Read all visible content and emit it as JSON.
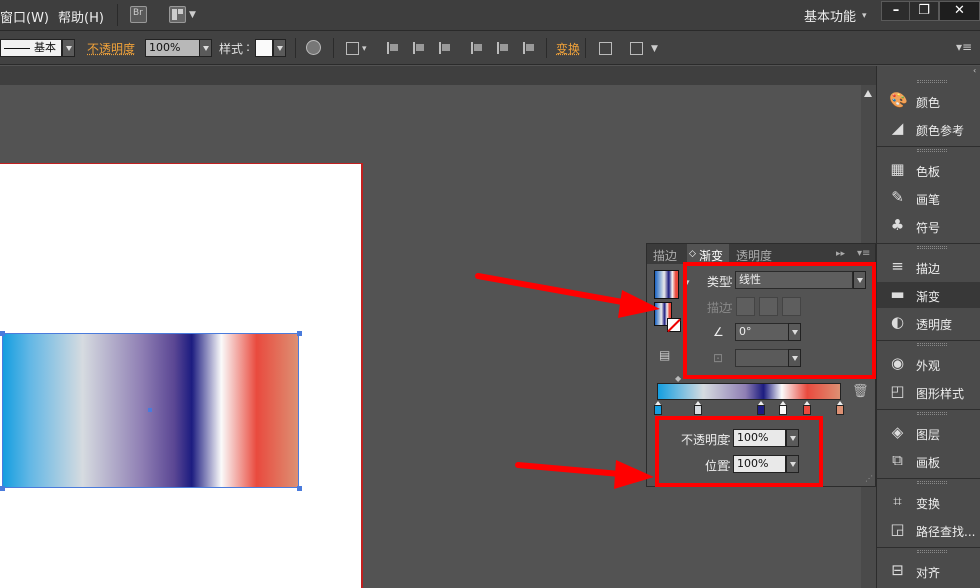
{
  "menubar": {
    "items": [
      "窗口(W)",
      "帮助(H)"
    ],
    "workspace": "基本功能",
    "window_buttons": [
      "–",
      "❐",
      "✕"
    ]
  },
  "controlbar": {
    "stroke_style": "基本",
    "opacity_label": "不透明度",
    "opacity_value": "100%",
    "style_label": "样式",
    "transform_label": "变换"
  },
  "gradient_panel": {
    "tabs": [
      "描边",
      "渐变",
      "透明度"
    ],
    "active_tab": "渐变",
    "type_label": "类型",
    "type_value": "线性",
    "stroke_label": "描边",
    "angle_value": "0°",
    "opacity_label": "不透明度",
    "opacity_value": "100%",
    "location_label": "位置",
    "location_value": "100%",
    "stop_count": 6
  },
  "dock": {
    "items": [
      {
        "label": "颜色",
        "icon": "palette-icon",
        "glyph": "🎨"
      },
      {
        "label": "颜色参考",
        "icon": "color-guide-icon",
        "glyph": "◢"
      },
      {
        "label": "色板",
        "icon": "swatches-icon",
        "glyph": "▦"
      },
      {
        "label": "画笔",
        "icon": "brushes-icon",
        "glyph": "✎"
      },
      {
        "label": "符号",
        "icon": "symbols-icon",
        "glyph": "♣"
      },
      {
        "label": "描边",
        "icon": "stroke-icon",
        "glyph": "≡"
      },
      {
        "label": "渐变",
        "icon": "gradient-icon",
        "glyph": "▬"
      },
      {
        "label": "透明度",
        "icon": "transparency-icon",
        "glyph": "◐"
      },
      {
        "label": "外观",
        "icon": "appearance-icon",
        "glyph": "◉"
      },
      {
        "label": "图形样式",
        "icon": "graphic-styles-icon",
        "glyph": "◰"
      },
      {
        "label": "图层",
        "icon": "layers-icon",
        "glyph": "◈"
      },
      {
        "label": "画板",
        "icon": "artboards-icon",
        "glyph": "⧉"
      },
      {
        "label": "变换",
        "icon": "transform-icon",
        "glyph": "⌗"
      },
      {
        "label": "路径查找...",
        "icon": "pathfinder-icon",
        "glyph": "◲"
      },
      {
        "label": "对齐",
        "icon": "align-icon",
        "glyph": "⊟"
      }
    ],
    "active": "渐变"
  },
  "colors": {
    "annotation_red": "#ff0000",
    "accent_orange": "#f0a23a",
    "selection_blue": "#4a7bdc"
  }
}
